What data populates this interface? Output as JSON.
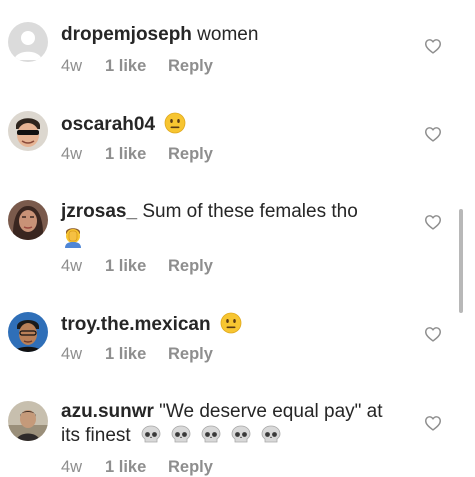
{
  "comments": [
    {
      "username": "dropemjoseph",
      "text": " women",
      "time": "4w",
      "likes": "1 like",
      "reply": "Reply",
      "avatar": "default-profile"
    },
    {
      "username": "oscarah04",
      "text": " ",
      "emoji": "neutral-face-emoji",
      "time": "4w",
      "likes": "1 like",
      "reply": "Reply",
      "avatar": "profile-photo"
    },
    {
      "username": "jzrosas_",
      "text": " Sum of these females tho",
      "emoji": "man-facepalming-emoji",
      "time": "4w",
      "likes": "1 like",
      "reply": "Reply",
      "avatar": "profile-photo"
    },
    {
      "username": "troy.the.mexican",
      "text": " ",
      "emoji": "neutral-face-emoji",
      "time": "4w",
      "likes": "1 like",
      "reply": "Reply",
      "avatar": "profile-photo"
    },
    {
      "username": "azu.sunwr",
      "text": " \"We deserve equal pay\" at its finest",
      "emoji": "skull-emoji x5",
      "time": "4w",
      "likes": "1 like",
      "reply": "Reply",
      "avatar": "profile-photo"
    }
  ],
  "icons": {
    "like": "heart-outline-icon"
  },
  "colors": {
    "text": "#262626",
    "meta": "#8e8e8e",
    "heart": "#8e8e8e",
    "emoji_yellow": "#f7c531"
  }
}
